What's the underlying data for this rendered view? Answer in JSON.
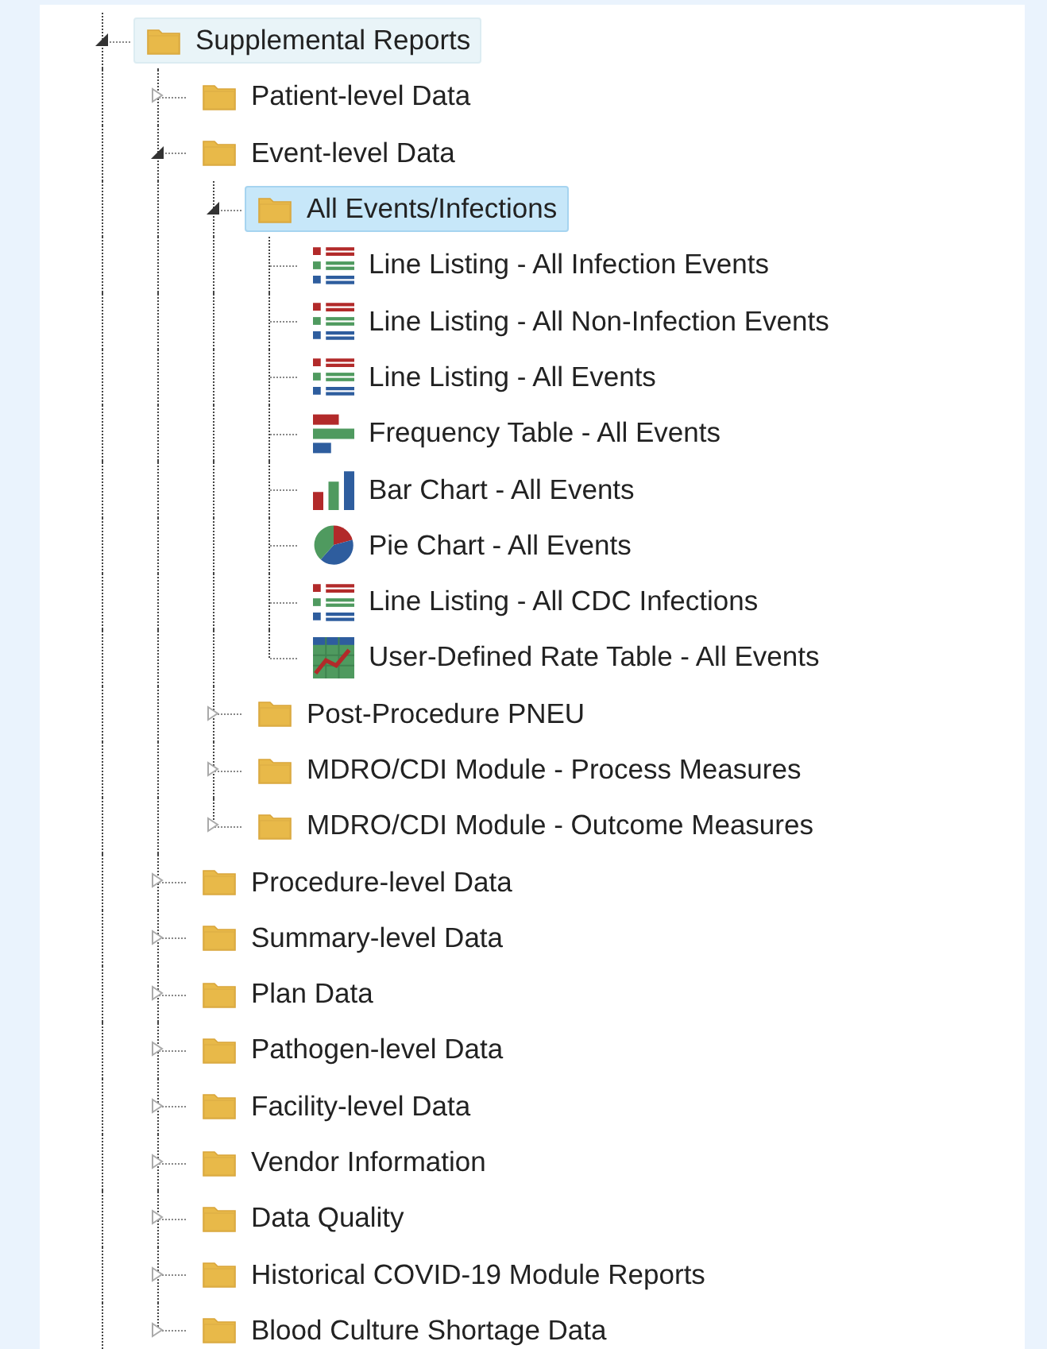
{
  "tree": [
    {
      "label": "Supplemental Reports",
      "kind": "folder",
      "expanded": true,
      "selected": false,
      "hovered": true,
      "children": [
        {
          "label": "Patient-level Data",
          "kind": "folder",
          "expanded": false,
          "selected": false,
          "hovered": false
        },
        {
          "label": "Event-level Data",
          "kind": "folder",
          "expanded": true,
          "selected": false,
          "hovered": false,
          "children": [
            {
              "label": "All Events/Infections",
              "kind": "folder",
              "expanded": true,
              "selected": true,
              "hovered": false,
              "children": [
                {
                  "label": "Line Listing - All Infection Events",
                  "kind": "listing",
                  "selected": false,
                  "hovered": false
                },
                {
                  "label": "Line Listing - All Non-Infection Events",
                  "kind": "listing",
                  "selected": false,
                  "hovered": false
                },
                {
                  "label": "Line Listing - All Events",
                  "kind": "listing",
                  "selected": false,
                  "hovered": false
                },
                {
                  "label": "Frequency Table - All Events",
                  "kind": "frequency",
                  "selected": false,
                  "hovered": false
                },
                {
                  "label": "Bar Chart - All Events",
                  "kind": "bar",
                  "selected": false,
                  "hovered": false
                },
                {
                  "label": "Pie Chart - All Events",
                  "kind": "pie",
                  "selected": false,
                  "hovered": false
                },
                {
                  "label": "Line Listing - All CDC Infections",
                  "kind": "listing",
                  "selected": false,
                  "hovered": false
                },
                {
                  "label": "User-Defined Rate Table - All Events",
                  "kind": "rate",
                  "selected": false,
                  "hovered": false
                }
              ]
            },
            {
              "label": "Post-Procedure PNEU",
              "kind": "folder",
              "expanded": false,
              "selected": false,
              "hovered": false
            },
            {
              "label": "MDRO/CDI Module - Process Measures",
              "kind": "folder",
              "expanded": false,
              "selected": false,
              "hovered": false
            },
            {
              "label": "MDRO/CDI Module - Outcome Measures",
              "kind": "folder",
              "expanded": false,
              "selected": false,
              "hovered": false
            }
          ]
        },
        {
          "label": "Procedure-level Data",
          "kind": "folder",
          "expanded": false,
          "selected": false,
          "hovered": false
        },
        {
          "label": "Summary-level Data",
          "kind": "folder",
          "expanded": false,
          "selected": false,
          "hovered": false
        },
        {
          "label": "Plan Data",
          "kind": "folder",
          "expanded": false,
          "selected": false,
          "hovered": false
        },
        {
          "label": "Pathogen-level Data",
          "kind": "folder",
          "expanded": false,
          "selected": false,
          "hovered": false
        },
        {
          "label": "Facility-level Data",
          "kind": "folder",
          "expanded": false,
          "selected": false,
          "hovered": false
        },
        {
          "label": "Vendor Information",
          "kind": "folder",
          "expanded": false,
          "selected": false,
          "hovered": false
        },
        {
          "label": "Data Quality",
          "kind": "folder",
          "expanded": false,
          "selected": false,
          "hovered": false
        },
        {
          "label": "Historical COVID-19 Module Reports",
          "kind": "folder",
          "expanded": false,
          "selected": false,
          "hovered": false
        },
        {
          "label": "Blood Culture Shortage Data",
          "kind": "folder",
          "expanded": false,
          "selected": false,
          "hovered": false
        }
      ]
    }
  ]
}
